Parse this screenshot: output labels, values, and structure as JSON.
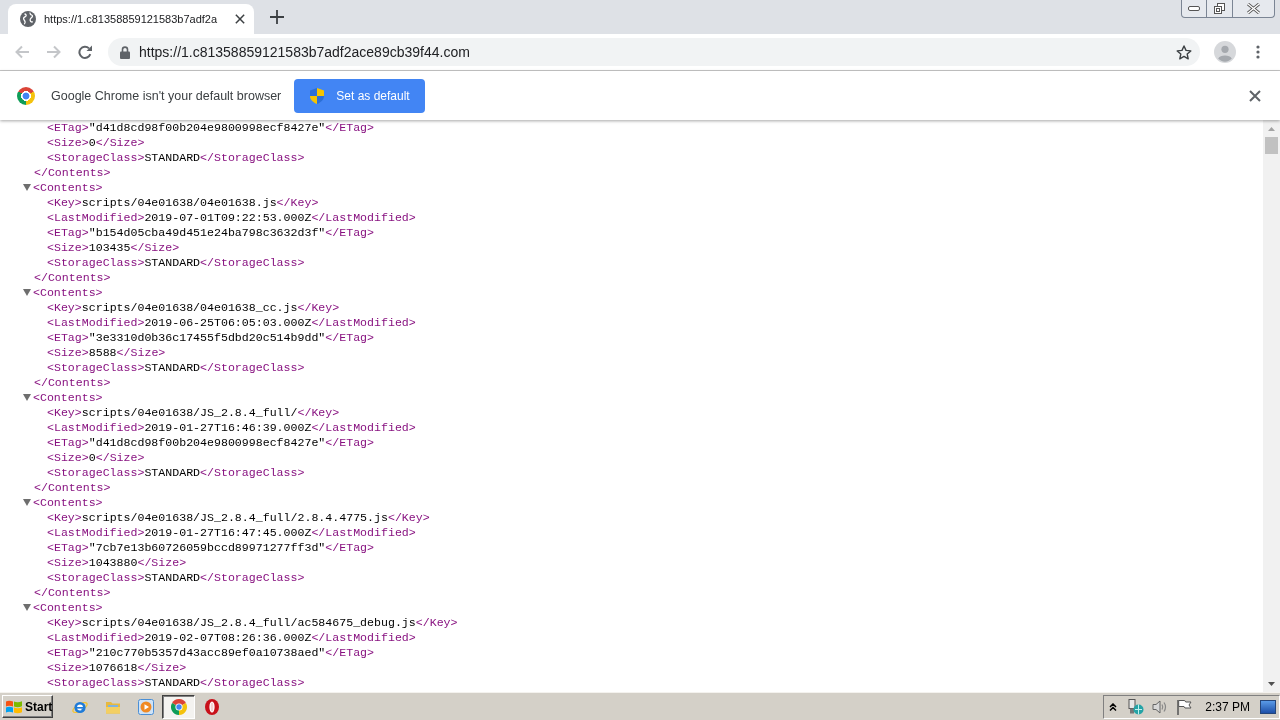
{
  "tabs": [
    {
      "title": "https://1.c81358859121583b7adf2a",
      "selected": true
    }
  ],
  "toolbar": {
    "nav_buttons": [
      {
        "kind": "back",
        "disabled": true
      },
      {
        "kind": "forward",
        "disabled": true
      },
      {
        "kind": "reload",
        "disabled": false
      }
    ],
    "url": "https://1.c81358859121583b7adf2ace89cb39f44.com"
  },
  "infobar": {
    "message": "Google Chrome isn't your default browser",
    "button": "Set as default"
  },
  "xml_view": {
    "nodes": [
      {
        "children": [
          {
            "open": "<ETag>",
            "value": "\"d41d8cd98f00b204e9800998ecf8427e\"",
            "close": "</ETag>"
          },
          {
            "open": "<Size>",
            "value": "0",
            "close": "</Size>"
          },
          {
            "open": "<StorageClass>",
            "value": "STANDARD",
            "close": "</StorageClass>"
          }
        ],
        "close_tag": "</Contents>"
      },
      {
        "expanded": true,
        "open_tag": "<Contents>",
        "children": [
          {
            "open": "<Key>",
            "value": "scripts/04e01638/04e01638.js",
            "close": "</Key>"
          },
          {
            "open": "<LastModified>",
            "value": "2019-07-01T09:22:53.000Z",
            "close": "</LastModified>"
          },
          {
            "open": "<ETag>",
            "value": "\"b154d05cba49d451e24ba798c3632d3f\"",
            "close": "</ETag>"
          },
          {
            "open": "<Size>",
            "value": "103435",
            "close": "</Size>"
          },
          {
            "open": "<StorageClass>",
            "value": "STANDARD",
            "close": "</StorageClass>"
          }
        ],
        "close_tag": "</Contents>"
      },
      {
        "expanded": true,
        "open_tag": "<Contents>",
        "children": [
          {
            "open": "<Key>",
            "value": "scripts/04e01638/04e01638_cc.js",
            "close": "</Key>"
          },
          {
            "open": "<LastModified>",
            "value": "2019-06-25T06:05:03.000Z",
            "close": "</LastModified>"
          },
          {
            "open": "<ETag>",
            "value": "\"3e3310d0b36c17455f5dbd20c514b9dd\"",
            "close": "</ETag>"
          },
          {
            "open": "<Size>",
            "value": "8588",
            "close": "</Size>"
          },
          {
            "open": "<StorageClass>",
            "value": "STANDARD",
            "close": "</StorageClass>"
          }
        ],
        "close_tag": "</Contents>"
      },
      {
        "expanded": true,
        "open_tag": "<Contents>",
        "children": [
          {
            "open": "<Key>",
            "value": "scripts/04e01638/JS_2.8.4_full/",
            "close": "</Key>"
          },
          {
            "open": "<LastModified>",
            "value": "2019-01-27T16:46:39.000Z",
            "close": "</LastModified>"
          },
          {
            "open": "<ETag>",
            "value": "\"d41d8cd98f00b204e9800998ecf8427e\"",
            "close": "</ETag>"
          },
          {
            "open": "<Size>",
            "value": "0",
            "close": "</Size>"
          },
          {
            "open": "<StorageClass>",
            "value": "STANDARD",
            "close": "</StorageClass>"
          }
        ],
        "close_tag": "</Contents>"
      },
      {
        "expanded": true,
        "open_tag": "<Contents>",
        "children": [
          {
            "open": "<Key>",
            "value": "scripts/04e01638/JS_2.8.4_full/2.8.4.4775.js",
            "close": "</Key>"
          },
          {
            "open": "<LastModified>",
            "value": "2019-01-27T16:47:45.000Z",
            "close": "</LastModified>"
          },
          {
            "open": "<ETag>",
            "value": "\"7cb7e13b60726059bccd89971277ff3d\"",
            "close": "</ETag>"
          },
          {
            "open": "<Size>",
            "value": "1043880",
            "close": "</Size>"
          },
          {
            "open": "<StorageClass>",
            "value": "STANDARD",
            "close": "</StorageClass>"
          }
        ],
        "close_tag": "</Contents>"
      },
      {
        "expanded": true,
        "open_tag": "<Contents>",
        "children": [
          {
            "open": "<Key>",
            "value": "scripts/04e01638/JS_2.8.4_full/ac584675_debug.js",
            "close": "</Key>"
          },
          {
            "open": "<LastModified>",
            "value": "2019-02-07T08:26:36.000Z",
            "close": "</LastModified>"
          },
          {
            "open": "<ETag>",
            "value": "\"210c770b5357d43acc89ef0a10738aed\"",
            "close": "</ETag>"
          },
          {
            "open": "<Size>",
            "value": "1076618",
            "close": "</Size>"
          },
          {
            "open": "<StorageClass>",
            "value": "STANDARD",
            "close": "</StorageClass>"
          }
        ]
      }
    ]
  },
  "taskbar": {
    "start": "Start",
    "items": [
      {
        "kind": "e-logo",
        "selected": false
      },
      {
        "kind": "folder",
        "selected": false
      },
      {
        "kind": "player",
        "selected": false
      },
      {
        "kind": "chrome",
        "selected": true
      },
      {
        "kind": "o-logo",
        "selected": false
      }
    ],
    "clock": "2:37 PM"
  }
}
